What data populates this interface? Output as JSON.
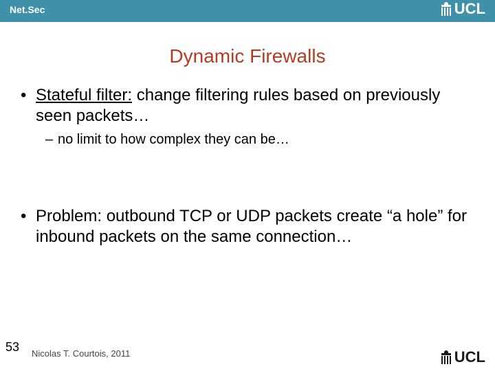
{
  "header": {
    "course_label": "Net.Sec",
    "logo_text": "UCL"
  },
  "content": {
    "title": "Dynamic Firewalls",
    "bullets": [
      {
        "lead_underlined": "Stateful filter:",
        "rest": " change filtering rules based on previously seen packets…",
        "sub": [
          "no limit to how complex they can be…"
        ]
      },
      {
        "lead_plain": "Problem: outbound TCP or UDP packets create ",
        "quoted": "“a hole”",
        "tail": " for inbound packets on the same connection…"
      }
    ]
  },
  "footer": {
    "page_number": "53",
    "author_line": "Nicolas T. Courtois, 2011",
    "logo_text": "UCL"
  }
}
